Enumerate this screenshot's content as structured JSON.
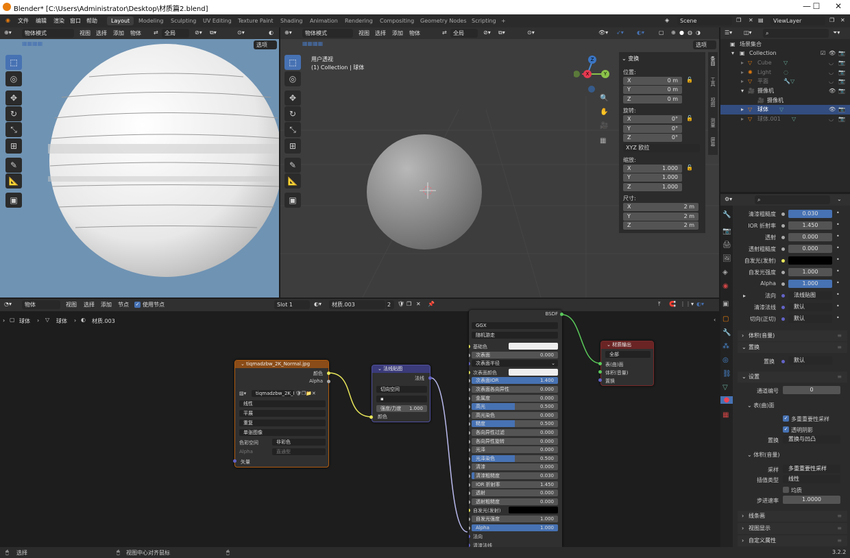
{
  "window": {
    "title": "Blender* [C:\\Users\\Administrator\\Desktop\\材质篇2.blend]",
    "min": "—",
    "max": "☐",
    "close": "✕"
  },
  "menu": [
    "文件",
    "编辑",
    "渲染",
    "窗口",
    "帮助"
  ],
  "workspaces": [
    "Layout",
    "Modeling",
    "Sculpting",
    "UV Editing",
    "Texture Paint",
    "Shading",
    "Animation",
    "Rendering",
    "Compositing",
    "Geometry Nodes",
    "Scripting",
    "+"
  ],
  "scene": "Scene",
  "viewlayer": "ViewLayer",
  "vp": {
    "mode": "物体模式",
    "menus": [
      "视图",
      "选择",
      "添加",
      "物体"
    ],
    "transform": "全局",
    "options": "选项"
  },
  "vp2": {
    "info1": "用户透视",
    "info2": "(1) Collection | 球体"
  },
  "npanel": {
    "header": "变换",
    "loc_label": "位置:",
    "loc": [
      "0 m",
      "0 m",
      "0 m"
    ],
    "rot_label": "旋转:",
    "rot": [
      "0°",
      "0°",
      "0°"
    ],
    "rot_mode": "XYZ 欧拉",
    "scale_label": "缩放:",
    "scale": [
      "1.000",
      "1.000",
      "1.000"
    ],
    "dim_label": "尺寸:",
    "dim": [
      "2 m",
      "2 m",
      "2 m"
    ],
    "axes": [
      "X",
      "Y",
      "Z"
    ],
    "tabs": [
      "条目",
      "工具",
      "视图",
      "测量",
      "屏幕"
    ]
  },
  "gizmo": {
    "x": "X",
    "y": "Y",
    "z": "Z"
  },
  "outliner": {
    "root": "场景集合",
    "items": [
      {
        "name": "Collection",
        "dim": false
      },
      {
        "name": "Cube",
        "dim": true
      },
      {
        "name": "Light",
        "dim": true
      },
      {
        "name": "平面",
        "dim": true
      },
      {
        "name": "摄像机",
        "dim": false
      },
      {
        "name": "摄像机",
        "dim": false
      },
      {
        "name": "球体",
        "dim": false
      },
      {
        "name": "球体.001",
        "dim": true
      }
    ]
  },
  "shader": {
    "mode": "物体",
    "menus": [
      "视图",
      "选择",
      "添加",
      "节点"
    ],
    "use_nodes": "使用节点",
    "slot": "Slot 1",
    "material": "材质.003",
    "users": "2",
    "breadcrumb": [
      "球体",
      "球体",
      "材质.003"
    ]
  },
  "node_img": {
    "title": "tiqmadzbw_2K_Normal.jpg",
    "out1": "颜色",
    "out2": "Alpha",
    "file": "tiqmadzbw_2K_N...",
    "opts": [
      "线性",
      "平展",
      "重复",
      "单张图像"
    ],
    "cs_label": "色彩空间",
    "cs": "非彩色",
    "alpha_label": "Alpha",
    "alpha": "直通型",
    "vector": "矢量"
  },
  "node_nm": {
    "title": "法线贴图",
    "out": "法线",
    "space": "切向空间",
    "strength_label": "强度/力度",
    "strength": "1.000",
    "color": "颜色"
  },
  "node_out": {
    "title": "材质输出",
    "target": "全部",
    "surf": "表(曲)面",
    "vol": "体积(音量)",
    "disp": "置换"
  },
  "bsdf": {
    "out": "BSDF",
    "dist": "GGX",
    "ss": "随机游走",
    "rows": [
      {
        "l": "基础色",
        "type": "white"
      },
      {
        "l": "次表面",
        "v": "0.000"
      },
      {
        "l": "次表面半径",
        "type": "drop"
      },
      {
        "l": "次表面颜色",
        "type": "white"
      },
      {
        "l": "次表面IOR",
        "v": "1.400",
        "f": 1
      },
      {
        "l": "次表面各向异性",
        "v": "0.000"
      },
      {
        "l": "金属度",
        "v": "0.000"
      },
      {
        "l": "高光",
        "v": "0.500",
        "f": 0.5
      },
      {
        "l": "高光染色",
        "v": "0.000"
      },
      {
        "l": "糙度",
        "v": "0.500",
        "f": 0.5
      },
      {
        "l": "各向异性过滤",
        "v": "0.000"
      },
      {
        "l": "各向异性旋转",
        "v": "0.000"
      },
      {
        "l": "光泽",
        "v": "0.000"
      },
      {
        "l": "光泽染色",
        "v": "0.500",
        "f": 0.5
      },
      {
        "l": "清漆",
        "v": "0.000"
      },
      {
        "l": "清漆粗糙度",
        "v": "0.030",
        "f": 0.03
      },
      {
        "l": "IOR 折射率",
        "v": "1.450"
      },
      {
        "l": "透射",
        "v": "0.000"
      },
      {
        "l": "透射粗糙度",
        "v": "0.000"
      },
      {
        "l": "自发光(发射)",
        "type": "black"
      },
      {
        "l": "自发光强度",
        "v": "1.000"
      },
      {
        "l": "Alpha",
        "v": "1.000",
        "f": 1
      },
      {
        "l": "法向",
        "type": "sock"
      },
      {
        "l": "清漆法线",
        "type": "sock"
      }
    ]
  },
  "props": {
    "rows": [
      {
        "l": "清漆粗糙度",
        "v": "0.030"
      },
      {
        "l": "IOR 折射率",
        "v": "1.450"
      },
      {
        "l": "透射",
        "v": "0.000"
      },
      {
        "l": "透射粗糙度",
        "v": "0.000"
      },
      {
        "l": "自发光(发射)",
        "v": ""
      },
      {
        "l": "自发光强度",
        "v": "1.000"
      },
      {
        "l": "Alpha",
        "v": "1.000"
      },
      {
        "l": "法向",
        "v": "法线贴图"
      },
      {
        "l": "清漆法线",
        "v": "默认"
      },
      {
        "l": "切向(正切)",
        "v": "默认"
      }
    ],
    "vol": "体积(音量)",
    "disp": "置换",
    "disp_label": "置换",
    "disp_val": "默认",
    "settings": "设置",
    "pass_label": "通道编号",
    "pass": "0",
    "surf": "表(曲)面",
    "mis": "多重重要性采样",
    "transp": "透明阴影",
    "disp_mode_label": "置换",
    "disp_mode": "置换与凹凸",
    "volsub": "体积(音量)",
    "samp_label": "采样",
    "samp": "多重重要性采样",
    "interp_label": "插值类型",
    "interp": "线性",
    "homog": "均质",
    "step_label": "步进速率",
    "step": "1.0000",
    "lineart": "线条画",
    "viewport": "视图显示",
    "custom": "自定义属性"
  },
  "status": {
    "select": "选择",
    "center": "视图中心对齐鼠标",
    "version": "3.2.2"
  },
  "colors": {
    "blue": "#4772b3",
    "orange": "#e87d0d"
  }
}
